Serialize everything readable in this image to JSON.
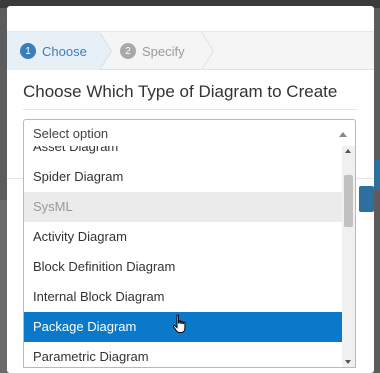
{
  "wizard": {
    "steps": [
      {
        "number": "1",
        "label": "Choose",
        "state": "active"
      },
      {
        "number": "2",
        "label": "Specify",
        "state": "inactive"
      }
    ]
  },
  "heading": "Choose Which Type of Diagram to Create",
  "select": {
    "value": "Select option"
  },
  "dropdown": {
    "options": [
      {
        "label": "Asset Diagram",
        "type": "option"
      },
      {
        "label": "Spider Diagram",
        "type": "option"
      },
      {
        "label": "SysML",
        "type": "group"
      },
      {
        "label": "Activity Diagram",
        "type": "option"
      },
      {
        "label": "Block Definition Diagram",
        "type": "option"
      },
      {
        "label": "Internal Block Diagram",
        "type": "option"
      },
      {
        "label": "Package Diagram",
        "type": "option",
        "highlighted": true
      },
      {
        "label": "Parametric Diagram",
        "type": "option"
      }
    ]
  },
  "icons": {
    "cursor": "hand-pointer-icon",
    "caret": "caret-up-icon"
  },
  "colors": {
    "accent": "#0a79c9",
    "step_active": "#3a7fb8"
  }
}
